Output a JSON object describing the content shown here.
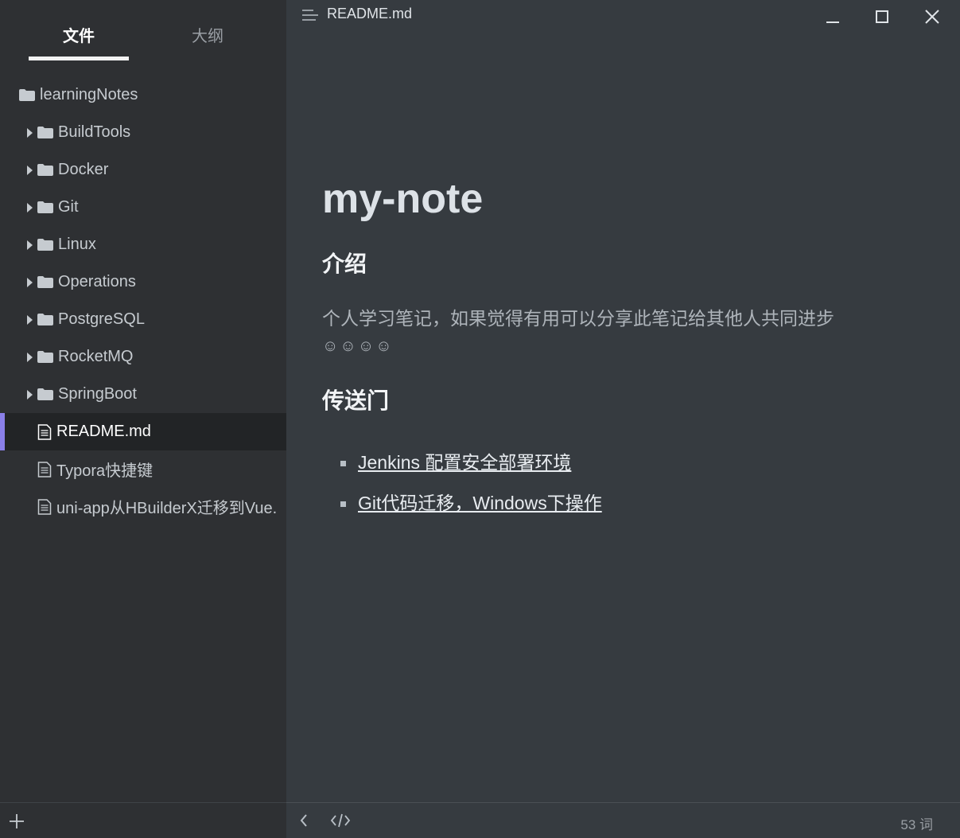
{
  "sidebar": {
    "tabs": {
      "files": "文件",
      "outline": "大纲"
    },
    "root": {
      "label": "learningNotes",
      "icon": "folder-icon"
    },
    "folders": [
      {
        "label": "BuildTools",
        "icon": "folder-icon"
      },
      {
        "label": "Docker",
        "icon": "folder-icon"
      },
      {
        "label": "Git",
        "icon": "folder-icon"
      },
      {
        "label": "Linux",
        "icon": "folder-icon"
      },
      {
        "label": "Operations",
        "icon": "folder-icon"
      },
      {
        "label": "PostgreSQL",
        "icon": "folder-icon"
      },
      {
        "label": "RocketMQ",
        "icon": "folder-icon"
      },
      {
        "label": "SpringBoot",
        "icon": "folder-icon"
      }
    ],
    "files": [
      {
        "label": "README.md",
        "icon": "file-icon",
        "active": true
      },
      {
        "label": "Typora快捷键",
        "icon": "file-icon"
      },
      {
        "label": "uni-app从HBuilderX迁移到Vue.",
        "icon": "file-icon"
      }
    ],
    "footer": {
      "add_icon": "plus-icon"
    }
  },
  "titlebar": {
    "title": "README.md",
    "icons": [
      "outline-toggle-icon",
      "minimize-icon",
      "maximize-icon",
      "close-icon"
    ]
  },
  "document": {
    "h1": "my-note",
    "intro_heading": "介绍",
    "intro_text": "个人学习笔记，如果觉得有用可以分享此笔记给其他人共同进步",
    "emoji": "☺☺☺☺",
    "links_heading": "传送门",
    "links": [
      {
        "label": "Jenkins 配置安全部署环境"
      },
      {
        "label": "Git代码迁移，Windows下操作"
      }
    ]
  },
  "statusbar": {
    "word_count": "53 词",
    "icons": [
      "back-arrow-icon",
      "source-code-icon"
    ]
  },
  "colors": {
    "sidebar_bg": "#2e3033",
    "editor_bg": "#363b40",
    "active_accent": "#8a7fe8"
  }
}
